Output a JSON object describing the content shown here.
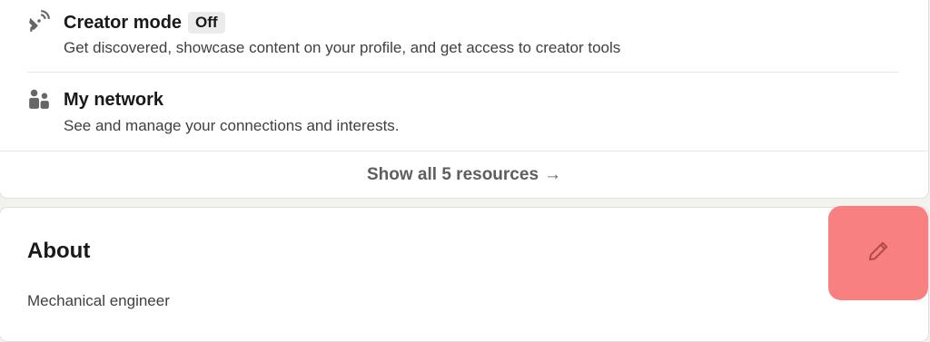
{
  "resources": {
    "creator_mode": {
      "icon": "satellite-dish-icon",
      "title": "Creator mode",
      "badge": "Off",
      "description": "Get discovered, showcase content on your profile, and get access to creator tools"
    },
    "my_network": {
      "icon": "people-icon",
      "title": "My network",
      "description": "See and manage your connections and interests."
    },
    "show_all_label": "Show all 5 resources",
    "show_all_arrow": "→"
  },
  "about": {
    "title": "About",
    "text": "Mechanical engineer",
    "edit_icon": "pencil-icon"
  },
  "colors": {
    "edit_highlight": "#f88080",
    "icon": "#666666"
  }
}
